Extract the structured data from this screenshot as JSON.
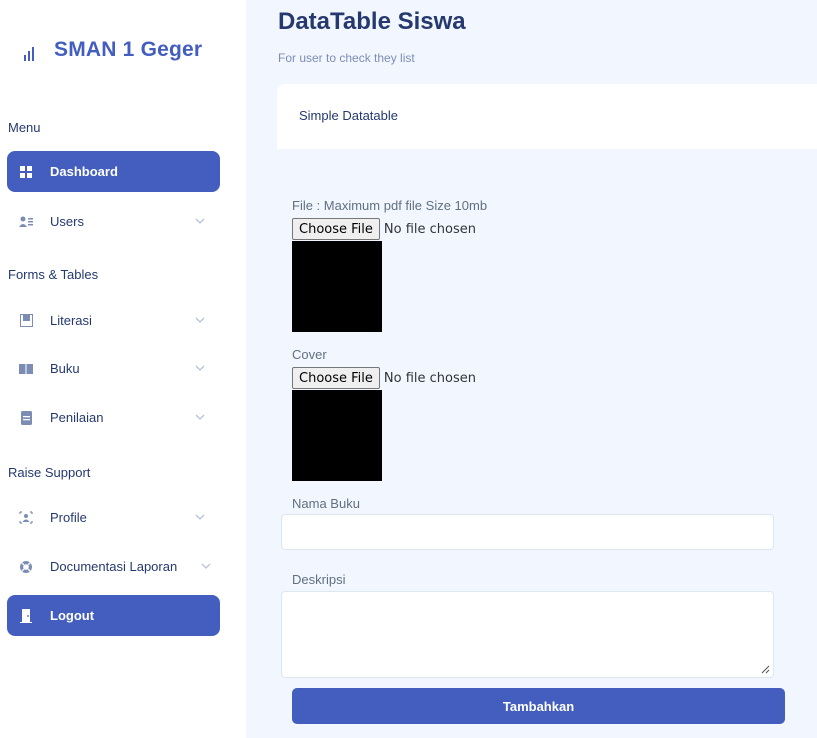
{
  "brand": {
    "name": "SMAN 1 Geger",
    "icon": "bar-chart-icon"
  },
  "sidebar": {
    "sections": [
      {
        "title": "Menu"
      },
      {
        "title": "Forms & Tables"
      },
      {
        "title": "Raise Support"
      }
    ],
    "items": [
      {
        "label": "Dashboard",
        "icon": "grid-icon",
        "active": true
      },
      {
        "label": "Users",
        "icon": "users-icon"
      },
      {
        "label": "Literasi",
        "icon": "window-icon"
      },
      {
        "label": "Buku",
        "icon": "book-icon"
      },
      {
        "label": "Penilaian",
        "icon": "file-icon"
      },
      {
        "label": "Profile",
        "icon": "person-badge-icon"
      },
      {
        "label": "Documentasi Laporan",
        "icon": "life-ring-icon"
      },
      {
        "label": "Logout",
        "icon": "door-icon",
        "active": true
      }
    ]
  },
  "header": {
    "title": "DataTable Siswa",
    "subtitle": "For user to check they list"
  },
  "card": {
    "title": "Simple Datatable"
  },
  "form": {
    "file_label": "File : Maximum pdf file Size 10mb",
    "file_button": "Choose File",
    "file_status": "No file chosen",
    "cover_label": "Cover",
    "cover_button": "Choose File",
    "cover_status": "No file chosen",
    "nama_label": "Nama Buku",
    "nama_value": "",
    "deskripsi_label": "Deskripsi",
    "deskripsi_value": "",
    "submit_label": "Tambahkan"
  },
  "colors": {
    "accent": "#435ebe",
    "text": "#25396f",
    "background": "#f2f7ff"
  }
}
